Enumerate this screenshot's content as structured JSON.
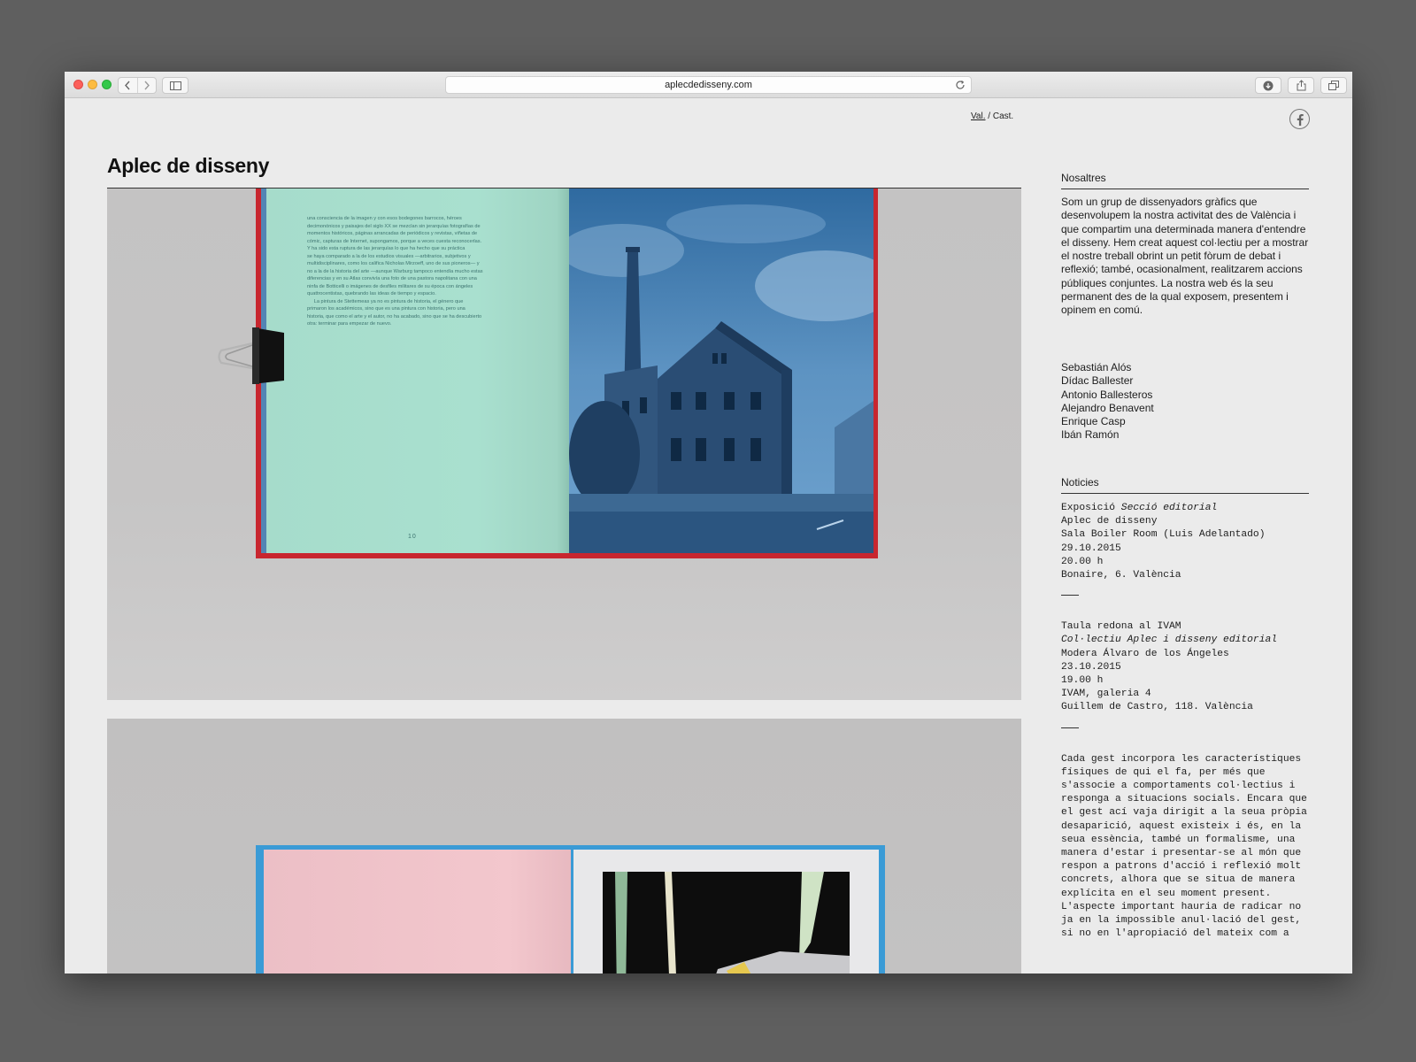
{
  "browser": {
    "url": "aplecdedisseny.com"
  },
  "header": {
    "lang_val": "Val.",
    "lang_sep": " / ",
    "lang_cast": "Cast.",
    "title": "Aplec de disseny"
  },
  "book1": {
    "text_lines": [
      "una consciencia de la imagen y con esos bodegones barrocos, héroes",
      "decimonónicos y paisajes del siglo XX se mezclan sin jerarquías fotografías de",
      "momentos históricos, páginas arrancadas de periódicos y revistas, viñetas de",
      "cómic, capturas de Internet, supongamos, porque a veces cuesta reconocerlas.",
      "Y ha sido esta ruptura de las jerarquías lo que ha hecho que su práctica",
      "se haya comparado a la de los estudios visuales —arbitrarios, subjetivos y",
      "multidisciplinares, como los califica Nicholas Mirzoeff, uno de sus pioneros— y",
      "no a la de la historia del arte —aunque Warburg tampoco entendía mucho estas",
      "diferencias y en su Atlas convivía una foto de una pastora napolitana con una",
      "ninfa de Botticelli o imágenes de desfiles militares de su época con ángeles",
      "quattrocentistas, quebrando las ideas de tiempo y espacio.",
      "     La pintura de Stettemeas ya no es pintura de historia, el género que",
      "primaron los académicos, sino que es una pintura con historia, pero una",
      "historia, que como el arte y el autor, no ha acabado, sino que se ha descubierto",
      "otra: terminar para empezar de nuevo."
    ],
    "page_number": "10"
  },
  "sidebar": {
    "about_heading": "Nosaltres",
    "about_text": "Som un grup de dissenyadors gràfics que desenvolupem la nostra activitat des de València i que compartim una determinada manera d'entendre el disseny. Hem creat aquest col·lectiu per a mostrar el nostre treball obrint un petit fòrum de debat i reflexió; també, ocasionalment, realitzarem accions públiques conjuntes. La nostra web és la seu permanent des de la qual exposem, presentem i opinem en comú.",
    "members": [
      "Sebastián Alós",
      "Dídac Ballester",
      "Antonio Ballesteros",
      "Alejandro Benavent",
      "Enrique Casp",
      "Ibán Ramón"
    ],
    "news_heading": "Noticies",
    "news1": {
      "line1_prefix": "Exposició ",
      "line1_italic": "Secció editorial",
      "lines": [
        "Aplec de disseny",
        "Sala Boiler Room (Luis Adelantado)",
        "29.10.2015",
        "20.00 h",
        "Bonaire, 6. València"
      ]
    },
    "news2": {
      "line1": "Taula redona al IVAM",
      "line2_italic": "Col·lectiu Aplec i disseny editorial",
      "lines": [
        "Modera Álvaro de los Ángeles",
        "23.10.2015",
        "19.00 h",
        "IVAM, galeria 4",
        "Guillem de Castro, 118. València"
      ]
    },
    "essay": "Cada gest incorpora les característiques físiques de qui el fa, per més que s'associe a comportaments col·lectius i responga a situacions socials. Encara que el gest ací vaja dirigit a la seua pròpia desaparició, aquest existeix i és, en la seua essència, també un formalisme, una manera d'estar i presentar-se al món que respon a patrons d'acció i reflexió molt concrets, alhora que se situa de manera explícita en el seu moment present. L'aspecte important hauria de radicar no ja en la impossible anul·lació del gest, si no en l'apropiació del mateix com a"
  }
}
